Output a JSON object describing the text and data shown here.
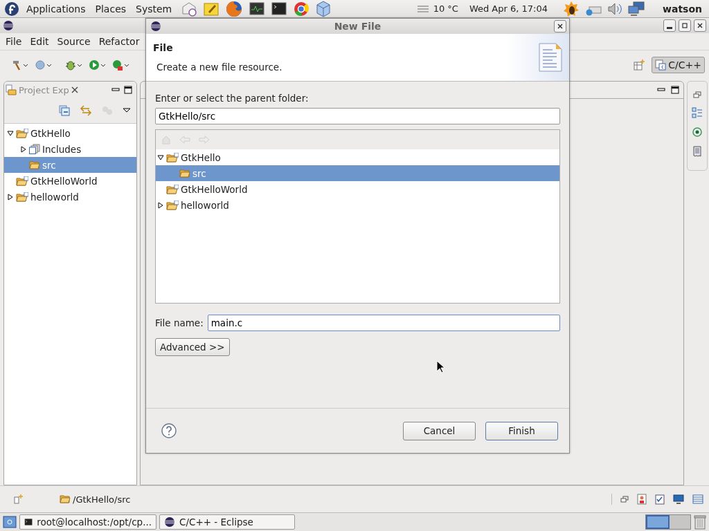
{
  "top_panel": {
    "menus": [
      "Applications",
      "Places",
      "System"
    ],
    "weather": "10 °C",
    "clock": "Wed Apr  6, 17:04",
    "user": "watson"
  },
  "eclipse": {
    "menus": [
      "File",
      "Edit",
      "Source",
      "Refactor"
    ],
    "perspective": {
      "label": "C/C++",
      "selected": true
    },
    "project_explorer": {
      "title": "Project Exp",
      "tree": [
        {
          "label": "GtkHello",
          "kind": "project",
          "expanded": true,
          "selected": false,
          "children": [
            {
              "label": "Includes",
              "kind": "includes",
              "expanded": false,
              "selected": false
            },
            {
              "label": "src",
              "kind": "folder",
              "selected": true
            }
          ]
        },
        {
          "label": "GtkHelloWorld",
          "kind": "project",
          "selected": false
        },
        {
          "label": "helloworld",
          "kind": "project",
          "expanded": false,
          "selected": false
        }
      ]
    },
    "status_path": "/GtkHello/src"
  },
  "dialog": {
    "title": "New File",
    "heading": "File",
    "description": "Create a new file resource.",
    "parent_label": "Enter or select the parent folder:",
    "parent_value": "GtkHello/src",
    "tree": [
      {
        "label": "GtkHello",
        "kind": "project",
        "expanded": true,
        "selected": false,
        "children": [
          {
            "label": "src",
            "kind": "folder",
            "selected": true
          }
        ]
      },
      {
        "label": "GtkHelloWorld",
        "kind": "project",
        "selected": false
      },
      {
        "label": "helloworld",
        "kind": "project",
        "expanded": false,
        "selected": false
      }
    ],
    "file_name_label": "File name:",
    "file_name_value": "main.c",
    "advanced_button": "Advanced >>",
    "buttons": [
      "Cancel",
      "Finish"
    ]
  },
  "taskbar": {
    "tasks": [
      "root@localhost:/opt/cp...",
      "C/C++ - Eclipse"
    ]
  }
}
